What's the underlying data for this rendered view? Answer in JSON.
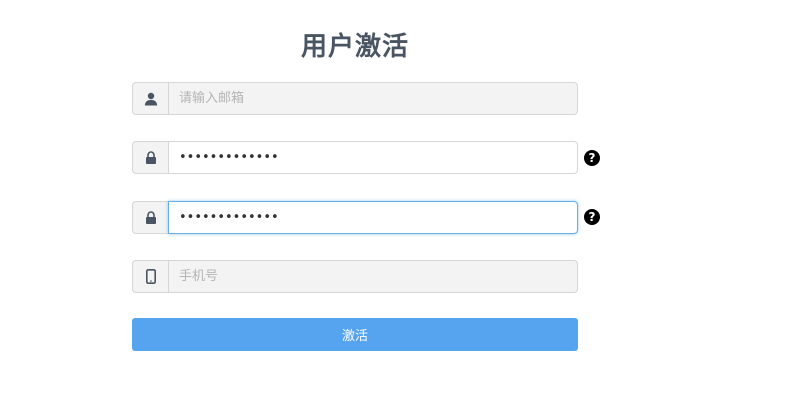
{
  "form": {
    "title": "用户激活",
    "email": {
      "placeholder": "请输入邮箱",
      "value": ""
    },
    "password": {
      "value": "•••••••••••••",
      "help_icon": "?"
    },
    "confirm_password": {
      "value": "•••••••••••••",
      "help_icon": "?"
    },
    "phone": {
      "placeholder": "手机号",
      "value": ""
    },
    "submit_label": "激活"
  },
  "icons": {
    "email": "user-icon",
    "password": "lock-icon",
    "confirm_password": "lock-icon",
    "phone": "mobile-phone-icon",
    "help": "question-circle-icon"
  },
  "colors": {
    "title": "#4a5563",
    "icon": "#4a5563",
    "submit_background": "#56a4f0",
    "focus_border": "#66afe9",
    "help_icon": "#000000"
  }
}
